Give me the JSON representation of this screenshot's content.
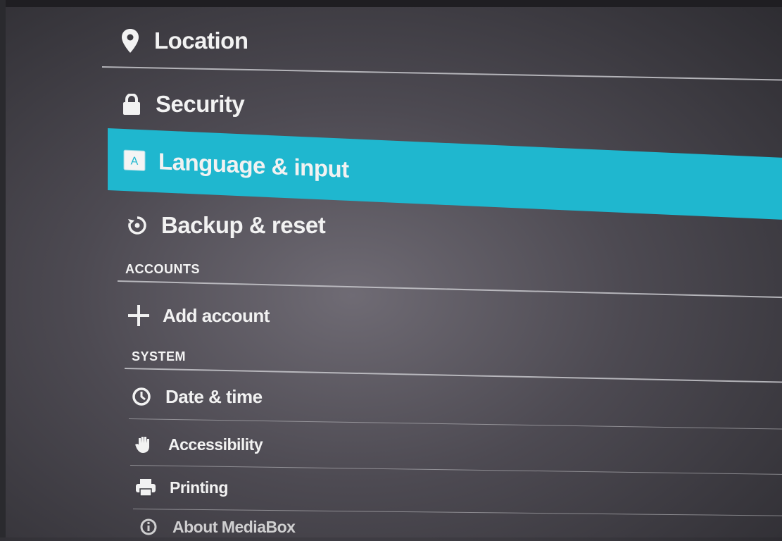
{
  "settings": {
    "items_personal": [
      {
        "label": "Location",
        "icon": "location-pin-icon"
      },
      {
        "label": "Security",
        "icon": "lock-icon"
      },
      {
        "label": "Language & input",
        "icon": "keyboard-a-icon"
      },
      {
        "label": "Backup & reset",
        "icon": "backup-reset-icon"
      }
    ],
    "accounts_header": "ACCOUNTS",
    "add_account_label": "Add account",
    "system_header": "SYSTEM",
    "items_system": [
      {
        "label": "Date & time",
        "icon": "clock-icon"
      },
      {
        "label": "Accessibility",
        "icon": "hand-icon"
      },
      {
        "label": "Printing",
        "icon": "printer-icon"
      },
      {
        "label": "About MediaBox",
        "icon": "info-icon"
      }
    ],
    "selected_item": "Language & input",
    "accent_color": "#1fb7cf"
  }
}
